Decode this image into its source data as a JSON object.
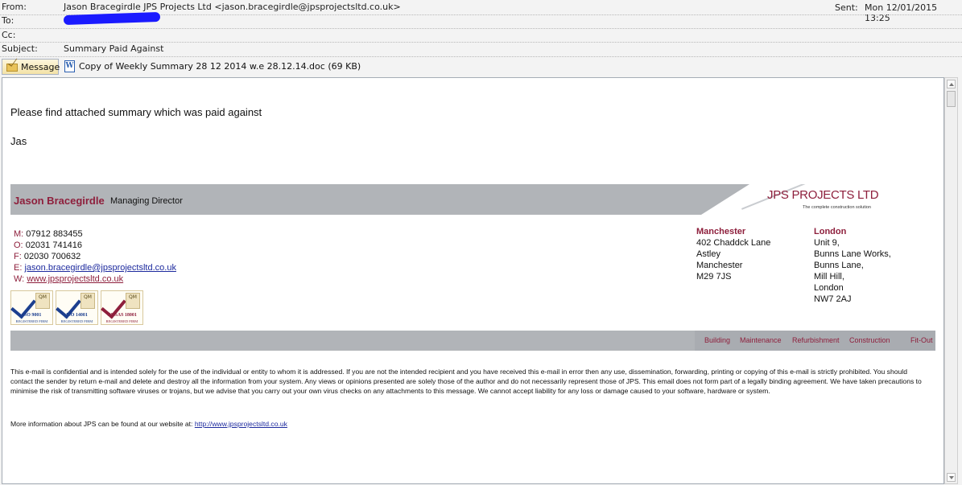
{
  "header": {
    "from_label": "From:",
    "from_value": "Jason Bracegirdle JPS Projects Ltd <jason.bracegirdle@jpsprojectsltd.co.uk>",
    "to_label": "To:",
    "cc_label": "Cc:",
    "subject_label": "Subject:",
    "subject_value": "Summary Paid Against",
    "sent_label": "Sent:",
    "sent_value": "Mon 12/01/2015 13:25"
  },
  "tabs": {
    "message_label": "Message",
    "attachment_label": "Copy of Weekly Summary 28 12 2014 w.e 28.12.14.doc (69 KB)"
  },
  "body": {
    "line1": "Please find attached summary which was paid against",
    "line2": "Jas"
  },
  "signature": {
    "name": "Jason Bracegirdle",
    "role": "Managing Director",
    "logo_text": "JPS PROJECTS LTD",
    "logo_tagline": "The complete construction solution",
    "contacts": [
      {
        "key": "M:",
        "value": "07912 883455"
      },
      {
        "key": "O:",
        "value": "02031 741416"
      },
      {
        "key": "F:",
        "value": "02030 700632"
      },
      {
        "key": "E:",
        "value": "jason.bracegirdle@jpsprojectsltd.co.uk"
      },
      {
        "key": "W:",
        "value": "www.jpsprojectsltd.co.uk"
      }
    ],
    "manchester": {
      "city": "Manchester",
      "lines": [
        "402 Chaddck Lane",
        "Astley",
        "Manchester",
        "M29 7JS"
      ]
    },
    "london": {
      "city": "London",
      "lines": [
        "Unit 9,",
        "Bunns Lane Works,",
        "Bunns Lane,",
        "Mill Hill,",
        "London",
        "NW7 2AJ"
      ]
    },
    "certs": [
      {
        "title": "ISO 9001",
        "sub": "REGISTERED FIRM",
        "qm": "QM"
      },
      {
        "title": "ISO 14001",
        "sub": "REGISTERED FIRM",
        "qm": "QM"
      },
      {
        "title": "OHSAS 18001",
        "sub": "REGISTERED FIRM",
        "qm": "QM"
      }
    ],
    "services": [
      "Building",
      "Maintenance",
      "Refurbishment",
      "Construction",
      "Fit-Out"
    ]
  },
  "disclaimer": "This e-mail is confidential and is intended solely for the use of the individual or entity to whom it is addressed. If you are not the intended recipient and you have received this e-mail in error then any use, dissemination, forwarding, printing or copying of this e-mail is strictly prohibited. You should contact the sender by return e-mail and delete and destroy all the information from your system. Any views or opinions presented are solely those of the author and do not necessarily represent those of JPS. This email does not form part of a legally binding agreement. We have taken precautions to minimise the risk of transmitting software viruses or trojans, but we advise that you carry out your own virus checks on any attachments to this message. We cannot accept liability for any loss or damage caused to your software, hardware or system.",
  "more_info": {
    "text": "More information about JPS can be found at our website at:",
    "link": "http://www.jpsprojectsltd.co.uk"
  },
  "colors": {
    "brand": "#8e1f3c",
    "band_gray": "#b1b4b8",
    "link": "#1d2a9e"
  }
}
